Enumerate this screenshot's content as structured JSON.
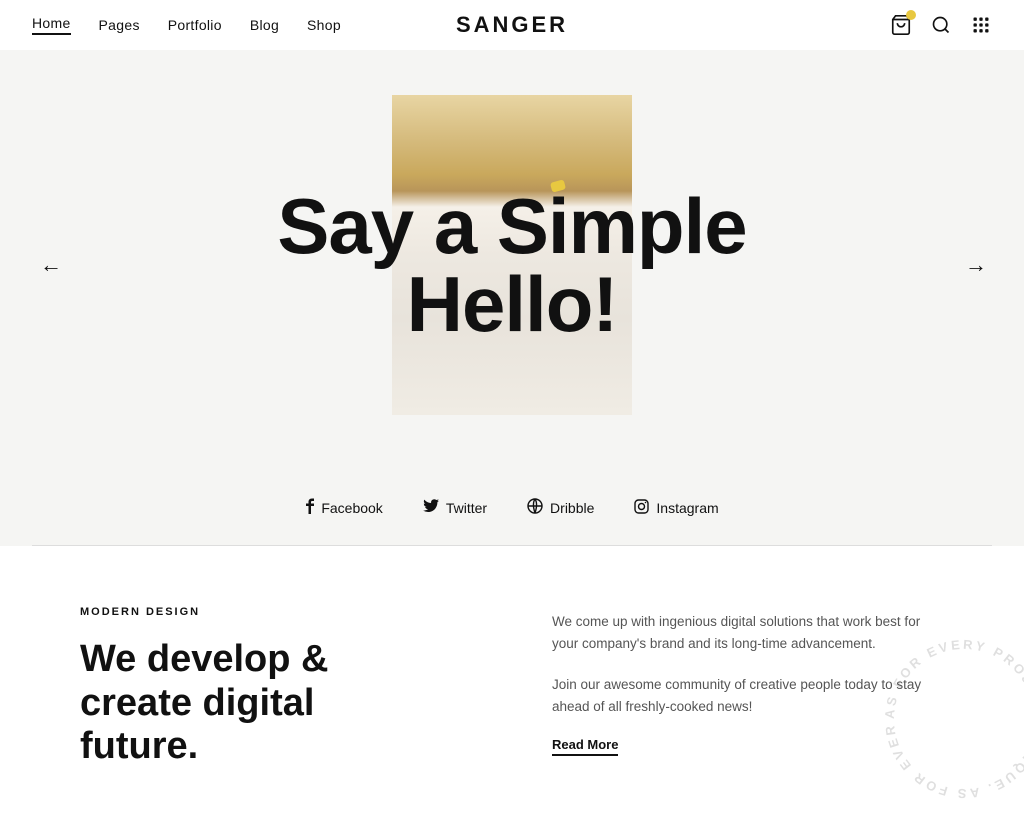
{
  "brand": {
    "name": "SANGER"
  },
  "nav": {
    "links": [
      {
        "label": "Home",
        "active": true
      },
      {
        "label": "Pages",
        "active": false
      },
      {
        "label": "Portfolio",
        "active": false
      },
      {
        "label": "Blog",
        "active": false
      },
      {
        "label": "Shop",
        "active": false
      }
    ],
    "cart_icon": "🛍",
    "search_icon": "🔍",
    "grid_icon": "⠿"
  },
  "hero": {
    "headline_line1": "Say a Simple",
    "headline_line2": "Hello!",
    "arrow_left": "←",
    "arrow_right": "→"
  },
  "social": {
    "links": [
      {
        "icon": "f",
        "label": "Facebook"
      },
      {
        "icon": "𝕋",
        "label": "Twitter"
      },
      {
        "icon": "⊛",
        "label": "Dribble"
      },
      {
        "icon": "◎",
        "label": "Instagram"
      }
    ]
  },
  "content": {
    "section_label": "MODERN DESIGN",
    "heading": "We develop & create digital future.",
    "paragraph1": "We come up with ingenious digital solutions that work best for your company's brand and its long-time advancement.",
    "paragraph2": "Join our awesome community of creative people today to stay ahead of all freshly-cooked news!",
    "read_more": "Read More"
  },
  "circular_text": "AS FOR EVERY PROJECT. UNIQUE"
}
